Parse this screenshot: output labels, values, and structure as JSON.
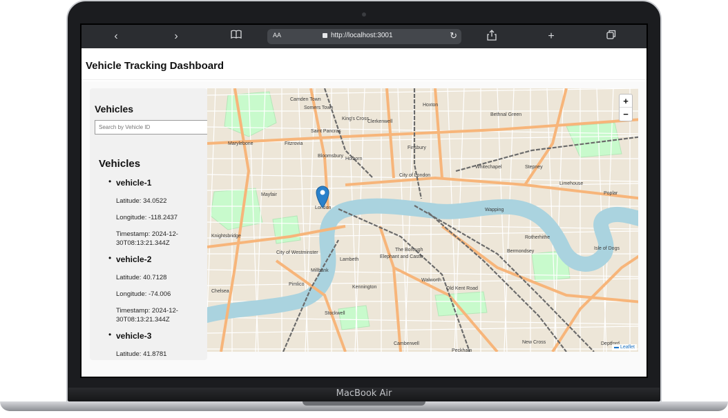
{
  "device": {
    "label": "MacBook Air"
  },
  "browser": {
    "reader_label": "AA",
    "url": "http://localhost:3001"
  },
  "app": {
    "title": "Vehicle Tracking Dashboard"
  },
  "sidebar": {
    "title": "Vehicles",
    "search_placeholder": "Search by Vehicle ID",
    "list_title": "Vehicles",
    "vehicles": [
      {
        "id": "vehicle-1",
        "latitude": "Latitude: 34.0522",
        "longitude": "Longitude: -118.2437",
        "timestamp": "Timestamp: 2024-12-30T08:13:21.344Z"
      },
      {
        "id": "vehicle-2",
        "latitude": "Latitude: 40.7128",
        "longitude": "Longitude: -74.006",
        "timestamp": "Timestamp: 2024-12-30T08:13:21.344Z"
      },
      {
        "id": "vehicle-3",
        "latitude": "Latitude: 41.8781"
      }
    ]
  },
  "map": {
    "zoom_in": "+",
    "zoom_out": "−",
    "attribution": "Leaflet",
    "labels": [
      "Camden Town",
      "Hoxton",
      "Somers Town",
      "King's Cross",
      "Saint Pancras",
      "Clerkenwell",
      "Finsbury",
      "Bethnal Green",
      "Marylebone",
      "Fitzrovia",
      "Bloomsbury",
      "Holborn",
      "Whitechapel",
      "City of London",
      "Stepney",
      "Mayfair",
      "London",
      "Wapping",
      "Limehouse",
      "Poplar",
      "Knightsbridge",
      "Lambeth",
      "The Borough",
      "Bermondsey",
      "Rotherhithe",
      "City of Westminster",
      "Elephant and Castle",
      "Isle of Dogs",
      "Pimlico",
      "Chelsea",
      "Kennington",
      "Walworth",
      "Old Kent Road",
      "Stockwell",
      "Camberwell",
      "Peckham",
      "New Cross",
      "Deptford",
      "Millbank"
    ],
    "colors": {
      "land": "#ede6d8",
      "water": "#aad3df",
      "park": "#c8facc",
      "major_road": "#f7b57a",
      "minor_road": "#ffffff",
      "rail": "#6b6b6b",
      "marker": "#2a81cb"
    }
  }
}
